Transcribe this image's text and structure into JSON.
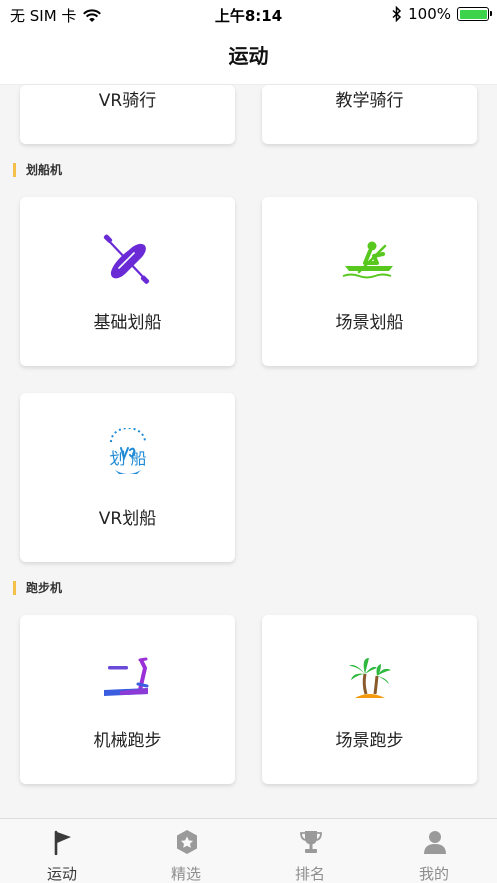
{
  "status": {
    "carrier": "无 SIM 卡",
    "time": "上午8:14",
    "battery_percent": "100%",
    "battery_level": 1.0
  },
  "nav": {
    "title": "运动"
  },
  "top_cards": [
    {
      "label": "VR骑行"
    },
    {
      "label": "教学骑行"
    }
  ],
  "sections": {
    "rowing": {
      "title": "划船机",
      "cards": [
        {
          "label": "基础划船",
          "icon": "kayak-paddle-icon"
        },
        {
          "label": "场景划船",
          "icon": "rower-scene-icon"
        },
        {
          "label": "VR划船",
          "icon": "vr-rowing-logo-icon",
          "logo_text": "划 船"
        }
      ]
    },
    "treadmill": {
      "title": "跑步机",
      "cards": [
        {
          "label": "机械跑步",
          "icon": "treadmill-icon"
        },
        {
          "label": "场景跑步",
          "icon": "palm-tree-icon"
        }
      ]
    }
  },
  "tabs": [
    {
      "label": "运动",
      "icon": "flag-icon",
      "active": true
    },
    {
      "label": "精选",
      "icon": "star-badge-icon",
      "active": false
    },
    {
      "label": "排名",
      "icon": "trophy-icon",
      "active": false
    },
    {
      "label": "我的",
      "icon": "person-icon",
      "active": false
    }
  ],
  "colors": {
    "accent_bar": "#f5c04a",
    "battery": "#3dd34a",
    "kayak_purple": "#6a2bd6",
    "rower_green": "#58c81e",
    "vr_blue": "#1f8ad6",
    "treadmill_blue": "#3a5de0",
    "treadmill_purple": "#9a30d8",
    "palm_green": "#2fb83e",
    "sand_orange": "#f59a0e"
  }
}
